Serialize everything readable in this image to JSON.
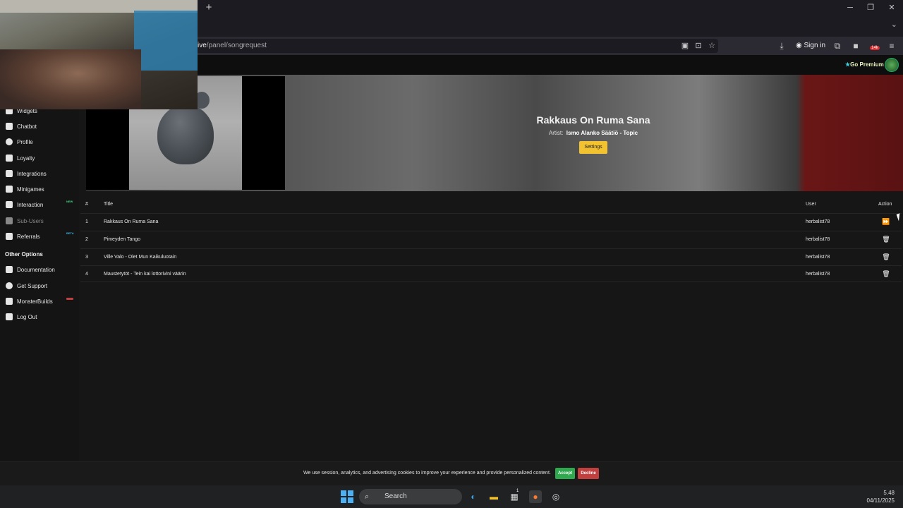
{
  "browser": {
    "new_tab": "+",
    "url_host": "ive",
    "url_path": "/panel/songrequest",
    "sign_in": "Sign in",
    "window_controls": [
      "─",
      "❐",
      "✕"
    ],
    "extension_badge": "14k"
  },
  "header": {
    "go_premium": "Go Premium"
  },
  "sidebar": {
    "items": [
      {
        "label": "Widgets",
        "icon": "widgets-icon"
      },
      {
        "label": "Chatbot",
        "icon": "chatbot-icon"
      },
      {
        "label": "Profile",
        "icon": "profile-icon"
      },
      {
        "label": "Loyalty",
        "icon": "trophy-icon"
      },
      {
        "label": "Integrations",
        "icon": "integrations-icon"
      },
      {
        "label": "Minigames",
        "icon": "gamepad-icon"
      },
      {
        "label": "Interaction",
        "icon": "music-icon",
        "tag": "NEW"
      },
      {
        "label": "Sub-Users",
        "icon": "sub-users-icon"
      },
      {
        "label": "Referrals",
        "icon": "referrals-icon",
        "tag": "BETA"
      }
    ],
    "section_title": "Other Options",
    "other_items": [
      {
        "label": "Documentation",
        "icon": "documentation-icon"
      },
      {
        "label": "Get Support",
        "icon": "support-icon"
      },
      {
        "label": "MonsterBuilds",
        "icon": "laptop-icon"
      },
      {
        "label": "Log Out",
        "icon": "logout-icon"
      }
    ]
  },
  "now_playing": {
    "title": "Rakkaus On Ruma Sana",
    "artist_label": "Artist:",
    "artist": "Ismo Alanko Säätiö - Topic",
    "settings_label": "Settings"
  },
  "queue": {
    "headers": {
      "num": "#",
      "title": "Title",
      "user": "User",
      "action": "Action"
    },
    "rows": [
      {
        "num": "1",
        "title": "Rakkaus On Ruma Sana",
        "user": "herbalist78",
        "action": "skip"
      },
      {
        "num": "2",
        "title": "Pimeyden Tango",
        "user": "herbalist78",
        "action": "delete"
      },
      {
        "num": "3",
        "title": "Ville Valo - Olet Mun Kaikuluotain",
        "user": "herbalist78",
        "action": "delete"
      },
      {
        "num": "4",
        "title": "Maustetytöt - Tein kai lottorivini väärin",
        "user": "herbalist78",
        "action": "delete"
      }
    ]
  },
  "cookie": {
    "text": "We use session, analytics, and advertising cookies to improve your experience and provide personalized content.",
    "accept": "Accept",
    "decline": "Decline"
  },
  "taskbar": {
    "search": "Search",
    "time": "5.48",
    "date": "04/11/2025",
    "store_badge": "1"
  },
  "colors": {
    "accent_yellow": "#f2c230",
    "accept_green": "#2fa84f",
    "decline_red": "#c0403f",
    "new_tag": "#3ddc84",
    "beta_tag": "#3bb3e0"
  }
}
